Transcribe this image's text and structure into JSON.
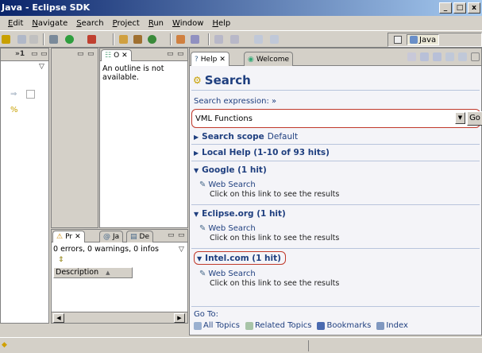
{
  "window": {
    "title": "Java - Eclipse SDK",
    "min_btn": "_",
    "max_btn": "□",
    "close_btn": "x"
  },
  "menu": [
    "Edit",
    "Navigate",
    "Search",
    "Project",
    "Run",
    "Window",
    "Help"
  ],
  "perspective": {
    "label": "Java"
  },
  "left_panel": {
    "tab_label": "»1",
    "chevron": "▽"
  },
  "outline": {
    "tab_label": "O",
    "close": "✕",
    "message": "An outline is not available."
  },
  "problems": {
    "tabs": [
      "Pr",
      "Ja",
      "De"
    ],
    "status": "0 errors, 0 warnings, 0 infos",
    "column": "Description",
    "sort_arrow": "▲",
    "scroll_left": "◀",
    "scroll_right": "▶"
  },
  "help": {
    "tabs": {
      "help": "Help",
      "welcome": "Welcome"
    },
    "title": "Search",
    "search_expression_label": "Search expression: »",
    "search_value": "VML Functions",
    "dropdown_arrow": "▼",
    "go_label": "Go",
    "search_scope": {
      "label": "Search scope",
      "value": "Default"
    },
    "sections": [
      {
        "arrow": "▶",
        "label": "Local Help (1-10 of 93 hits)"
      },
      {
        "arrow": "▼",
        "label": "Google (1 hit)",
        "link": "Web Search",
        "desc": "Click on this link to see the results"
      },
      {
        "arrow": "▼",
        "label": "Eclipse.org (1 hit)",
        "link": "Web Search",
        "desc": "Click on this link to see the results"
      },
      {
        "arrow": "▼",
        "label": "Intel.com (1 hit)",
        "link": "Web Search",
        "desc": "Click on this link to see the results"
      }
    ],
    "goto_label": "Go To:",
    "goto_links": [
      "All Topics",
      "Related Topics",
      "Bookmarks",
      "Index"
    ]
  },
  "colors": {
    "help_blue": "#1f3f7f",
    "highlight_red": "#c0392b"
  }
}
